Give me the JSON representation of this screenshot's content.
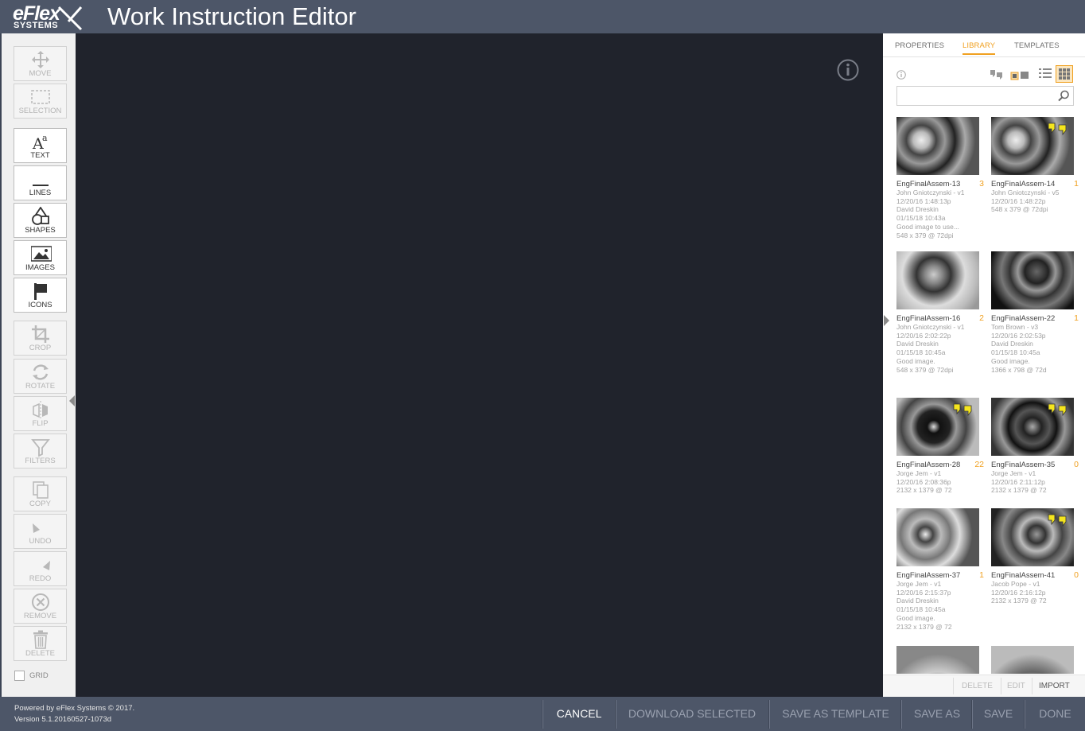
{
  "header": {
    "logo_top": "eFlex",
    "logo_bottom": "SYSTEMS",
    "title": "Work Instruction Editor"
  },
  "toolbar": {
    "tools": [
      {
        "label": "MOVE",
        "icon": "move-icon",
        "enabled": false
      },
      {
        "label": "SELECTION",
        "icon": "selection-icon",
        "enabled": false
      },
      {
        "label": "TEXT",
        "icon": "text-icon",
        "enabled": true
      },
      {
        "label": "LINES",
        "icon": "lines-icon",
        "enabled": true
      },
      {
        "label": "SHAPES",
        "icon": "shapes-icon",
        "enabled": true
      },
      {
        "label": "IMAGES",
        "icon": "images-icon",
        "enabled": true
      },
      {
        "label": "ICONS",
        "icon": "flag-icon",
        "enabled": true
      },
      {
        "label": "CROP",
        "icon": "crop-icon",
        "enabled": false
      },
      {
        "label": "ROTATE",
        "icon": "rotate-icon",
        "enabled": false
      },
      {
        "label": "FLIP",
        "icon": "flip-icon",
        "enabled": false
      },
      {
        "label": "FILTERS",
        "icon": "filter-icon",
        "enabled": false
      },
      {
        "label": "COPY",
        "icon": "copy-icon",
        "enabled": false
      },
      {
        "label": "UNDO",
        "icon": "undo-icon",
        "enabled": false
      },
      {
        "label": "REDO",
        "icon": "redo-icon",
        "enabled": false
      },
      {
        "label": "REMOVE",
        "icon": "remove-icon",
        "enabled": false
      },
      {
        "label": "DELETE",
        "icon": "trash-icon",
        "enabled": false
      }
    ],
    "grid_label": "GRID",
    "grid_checked": false
  },
  "panel": {
    "tabs": [
      "PROPERTIES",
      "LIBRARY",
      "TEMPLATES"
    ],
    "active_tab": "LIBRARY",
    "search_placeholder": "",
    "items": [
      {
        "title": "EngFinalAssem-13",
        "count": "3",
        "meta": [
          "John Gniotczynski - v1",
          "12/20/16 1:48:13p",
          "David Dreskin",
          "01/15/18 10:43a",
          "Good image to use...",
          "548 x 379 @ 72dpi"
        ]
      },
      {
        "title": "EngFinalAssem-14",
        "count": "1",
        "meta": [
          "John Gniotczynski - v5",
          "12/20/16 1:48:22p",
          "548 x 379 @ 72dpi"
        ]
      },
      {
        "title": "EngFinalAssem-16",
        "count": "2",
        "meta": [
          "John Gniotczynski - v1",
          "12/20/16 2:02:22p",
          "David Dreskin",
          "01/15/18 10:45a",
          "Good image.",
          "548 x 379 @ 72dpi"
        ]
      },
      {
        "title": "EngFinalAssem-22",
        "count": "1",
        "meta": [
          "Tom Brown - v3",
          "12/20/16 2:02:53p",
          "David Dreskin",
          "01/15/18 10:45a",
          "Good image.",
          "1366 x 798 @ 72d"
        ]
      },
      {
        "title": "EngFinalAssem-28",
        "count": "22",
        "meta": [
          "Jorge Jem - v1",
          "12/20/16 2:08:36p",
          "2132 x 1379 @ 72"
        ]
      },
      {
        "title": "EngFinalAssem-35",
        "count": "0",
        "meta": [
          "Jorge Jem - v1",
          "12/20/16 2:11:12p",
          "2132 x 1379 @ 72"
        ]
      },
      {
        "title": "EngFinalAssem-37",
        "count": "1",
        "meta": [
          "Jorge Jem - v1",
          "12/20/16 2:15:37p",
          "David Dreskin",
          "01/15/18 10:45a",
          "Good image.",
          "2132 x 1379 @ 72"
        ]
      },
      {
        "title": "EngFinalAssem-41",
        "count": "0",
        "meta": [
          "Jacob Pope - v1",
          "12/20/16 2:16:12p",
          "2132 x 1379 @ 72"
        ]
      },
      {
        "title": "",
        "count": "",
        "meta": []
      },
      {
        "title": "",
        "count": "",
        "meta": []
      }
    ],
    "footer": {
      "delete": "DELETE",
      "edit": "EDIT",
      "import": "IMPORT"
    }
  },
  "footer": {
    "powered": "Powered by eFlex Systems © 2017.",
    "version": "Version 5.1.20160527-1073d",
    "buttons": [
      "CANCEL",
      "DOWNLOAD SELECTED",
      "SAVE AS TEMPLATE",
      "SAVE AS",
      "SAVE",
      "DONE"
    ]
  },
  "colors": {
    "accent": "#f0a020",
    "chrome": "#4d5668",
    "canvas": "#20232c"
  }
}
